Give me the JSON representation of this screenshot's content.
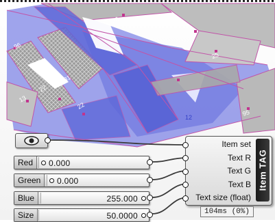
{
  "sliders": [
    {
      "label": "Red",
      "value": "0.000"
    },
    {
      "label": "Green",
      "value": "0.000"
    },
    {
      "label": "Blue",
      "value": "255.000"
    },
    {
      "label": "Size",
      "value": "50.0000"
    }
  ],
  "component": {
    "name": "Item TAG",
    "inputs": [
      "Item set",
      "Text R",
      "Text G",
      "Text B",
      "Text size (float)"
    ],
    "timing": "104ms (0%)"
  },
  "viewport": {
    "tags": [
      "26",
      "25",
      "96",
      "31",
      "12",
      "22",
      "13",
      "22",
      "95"
    ],
    "surface_color": "#7f86e6",
    "edge_color": "#c154a8",
    "grey_color": "#a8a8a8"
  }
}
